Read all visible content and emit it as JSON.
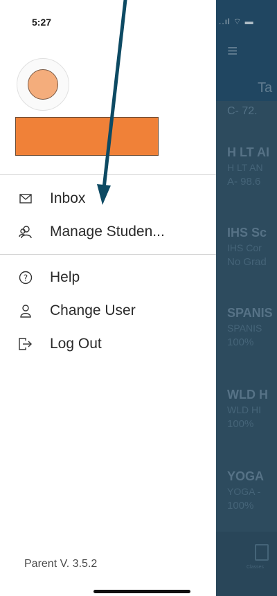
{
  "status_bar": {
    "time": "5:27"
  },
  "drawer": {
    "menu_primary": [
      {
        "label": "Inbox",
        "icon": "mail-icon"
      },
      {
        "label": "Manage Studen...",
        "icon": "students-icon"
      }
    ],
    "menu_secondary": [
      {
        "label": "Help",
        "icon": "help-icon"
      },
      {
        "label": "Change User",
        "icon": "user-icon"
      },
      {
        "label": "Log Out",
        "icon": "logout-icon"
      }
    ],
    "version": "Parent V. 3.5.2"
  },
  "background_app": {
    "status_icons": "..ıl ⌔ ▬",
    "tab_fragment": "Ta",
    "top_grade": "C- 72.",
    "courses": [
      {
        "title": "H LT AI",
        "subtitle": "H LT AN",
        "grade": "A- 98.6"
      },
      {
        "title": "IHS Sc",
        "subtitle": "IHS Cor",
        "grade": "No Grad"
      },
      {
        "title": "SPANIS",
        "subtitle": "SPANIS",
        "grade": "100%"
      },
      {
        "title": "WLD H",
        "subtitle": "WLD HI",
        "grade": "100%"
      },
      {
        "title": "YOGA",
        "subtitle": "YOGA -",
        "grade": "100%"
      }
    ],
    "tab_label": "Classes"
  },
  "colors": {
    "avatar_fill": "#f4ad7c",
    "name_redaction": "#f08138",
    "overlay": "#2e4d60",
    "annotation_arrow": "#0d4a63"
  }
}
